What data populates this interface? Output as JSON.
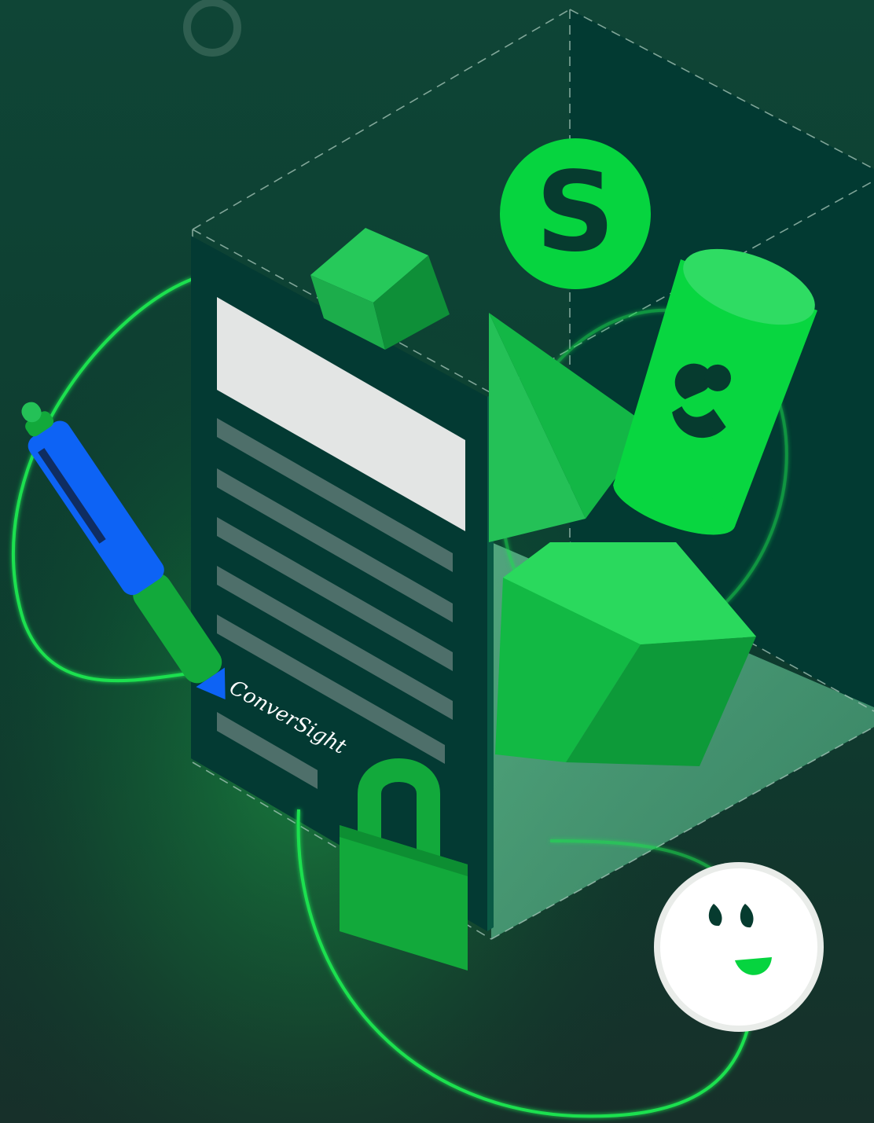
{
  "illustration": {
    "signature_text": "ConverSight",
    "badge_letter": "S",
    "colors": {
      "background_top": "#0f4535",
      "background_bottom": "#17302a",
      "box_dark": "#023b33",
      "box_side": "#04352d",
      "green_bright": "#06d43f",
      "green_mid": "#10b83b",
      "green_dark": "#0a9a36",
      "doc_header": "#e3e5e4",
      "doc_line": "#4e6f6a",
      "pen_blue": "#0d63f5",
      "lock_green": "#12a93b",
      "mascot_white": "#ffffff"
    }
  }
}
